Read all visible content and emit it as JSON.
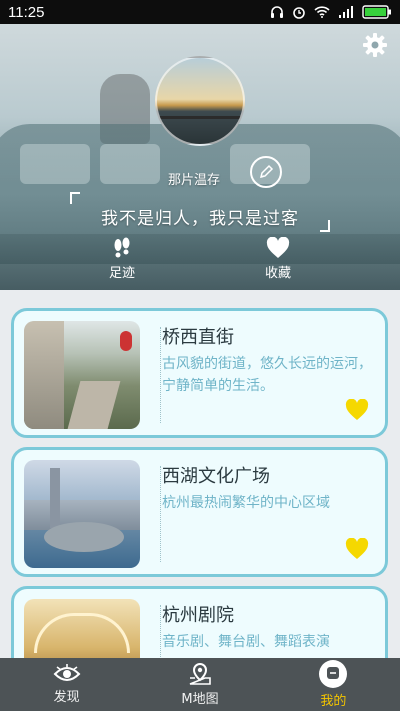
{
  "status_bar": {
    "time": "11:25"
  },
  "profile": {
    "username": "那片温存",
    "motto": "我不是归人，我只是过客",
    "actions": [
      {
        "label": "足迹",
        "icon": "footprints-icon"
      },
      {
        "label": "收藏",
        "icon": "heart-icon"
      }
    ]
  },
  "places": [
    {
      "title": "桥西直街",
      "description": "古风貌的街道，悠久长远的运河，宁静简单的生活。",
      "favorited": true
    },
    {
      "title": "西湖文化广场",
      "description": "杭州最热闹繁华的中心区域",
      "favorited": true
    },
    {
      "title": "杭州剧院",
      "description": "音乐剧、舞台剧、舞蹈表演",
      "favorited": true
    }
  ],
  "bottom_nav": [
    {
      "label": "发现",
      "icon": "eye-icon",
      "active": false
    },
    {
      "label": "M地图",
      "icon": "map-pin-icon",
      "active": false
    },
    {
      "label": "我的",
      "icon": "profile-icon",
      "active": true
    }
  ],
  "colors": {
    "accent": "#7cc9d9",
    "heart": "#f5d800",
    "nav_bg": "#4d5356",
    "active_tab": "#f3c400"
  }
}
